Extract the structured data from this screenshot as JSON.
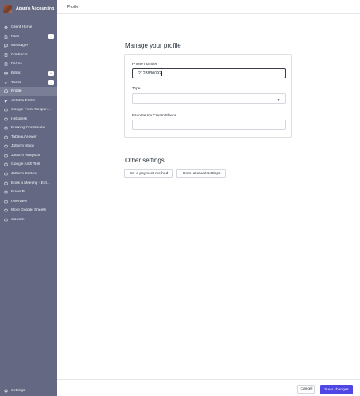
{
  "app": {
    "name": "Adam's Accounting"
  },
  "sidebar": {
    "items": [
      {
        "label": "Client Home",
        "icon": "home-icon"
      },
      {
        "label": "Files",
        "icon": "file-icon",
        "badge": "1"
      },
      {
        "label": "Messages",
        "icon": "chat-icon"
      },
      {
        "label": "Contracts",
        "icon": "contract-icon"
      },
      {
        "label": "Forms",
        "icon": "form-icon"
      },
      {
        "label": "Billing",
        "icon": "billing-icon",
        "badge": "0"
      },
      {
        "label": "Tasks",
        "icon": "tasks-icon",
        "badge": "1"
      },
      {
        "label": "Profile",
        "icon": "profile-icon",
        "active": true
      },
      {
        "label": "Airtable Editor",
        "icon": "airtable-icon"
      },
      {
        "label": "Google Form Respon...",
        "icon": "app-icon"
      },
      {
        "label": "Helpdesk",
        "icon": "app-icon"
      },
      {
        "label": "Booking Confirmatio...",
        "icon": "app-icon"
      },
      {
        "label": "Tableau Viewer",
        "icon": "app-icon"
      },
      {
        "label": "Jotform Inbox",
        "icon": "app-icon"
      },
      {
        "label": "Jotform Analytics",
        "icon": "app-icon"
      },
      {
        "label": "Google Auth Test",
        "icon": "app-icon"
      },
      {
        "label": "Jotform Embed",
        "icon": "app-icon"
      },
      {
        "label": "Book a Meeting - Ent...",
        "icon": "app-icon"
      },
      {
        "label": "PowerBI",
        "icon": "app-icon"
      },
      {
        "label": "Overview",
        "icon": "app-icon"
      },
      {
        "label": "More Google Sheets",
        "icon": "app-icon"
      },
      {
        "label": "cal.com",
        "icon": "app-icon"
      }
    ],
    "settings_label": "Settings"
  },
  "topbar": {
    "title": "Profile"
  },
  "profile": {
    "title": "Manage your profile",
    "phone_label": "Phone number",
    "phone_value": "2123830092",
    "type_label": "Type",
    "type_value": "",
    "flavor_label": "Favorite Ice Cream Flavor",
    "flavor_value": ""
  },
  "other": {
    "title": "Other settings",
    "payment_button": "Set a payment method",
    "account_button": "Go to account settings"
  },
  "footer": {
    "cancel_label": "Cancel",
    "save_label": "Save changes"
  },
  "colors": {
    "sidebar_bg": "#646882",
    "sidebar_active": "#7a7e97",
    "primary": "#4f46e5"
  }
}
